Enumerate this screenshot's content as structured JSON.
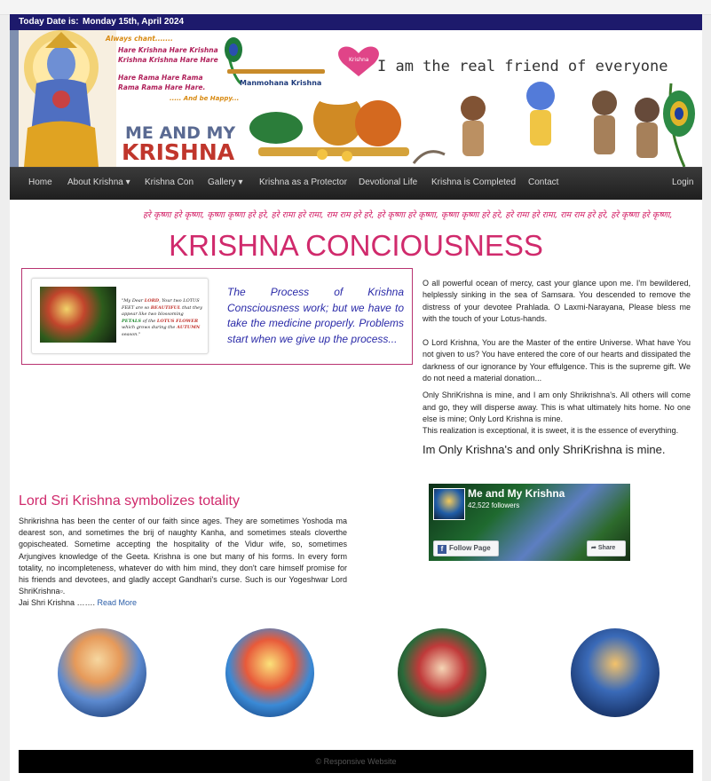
{
  "datebar": {
    "label": "Today Date is:",
    "value": "Monday 15th, April 2024"
  },
  "banner": {
    "chant_lines": [
      "Always chant.......",
      "Hare Krishna Hare Krishna",
      "Krishna Krishna Hare Hare",
      "Hare Rama Hare Rama",
      "Rama Rama Hare Hare.",
      "..... And be Happy..."
    ],
    "flute_caption": "Manmohana Krishna",
    "brand_line1": "ME AND MY",
    "brand_line2": "KRISHNA",
    "heart_label": "Krishna",
    "tagline": "I am the real friend of everyone"
  },
  "nav": {
    "items": [
      "Home",
      "About Krishna ▾",
      "Krishna Con",
      "Gallery ▾",
      "Krishna as a Protector",
      "Devotional Life",
      "Krishna is Completed",
      "Contact"
    ],
    "login": "Login"
  },
  "marquee": "हरे कृष्णा हरे कृष्णा, कृष्णा कृष्णा हरे हरे, हरे रामा हरे रामा, राम राम हरे हरे, हरे कृष्णा हरे कृष्णा, कृष्णा कृष्णा हरे हरे, हरे रामा हरे रामा, राम राम हरे हरे, हरे कृष्णा हरे कृष्णा,",
  "main_title": "KRISHNA CONCIOUSNESS",
  "quote_box": {
    "image_text": {
      "t1": "\"My Dear ",
      "t2": "LORD",
      "t3": ", Your two LOTUS FEET are so ",
      "t4": "BEAUTIFUL",
      "t5": " that they appear like two blossoming ",
      "t6": "PETALS",
      "t7": " of the ",
      "t8": "LOTUS FLOWER",
      "t9": " which grows during the ",
      "t10": "AUTUMN",
      "t11": " season.\""
    },
    "quote": "The Process of Krishna Consciousness work; but we have to take the medicine properly. Problems start when we give up the process..."
  },
  "prayers": {
    "p1": "O all powerful ocean of mercy, cast your glance upon me. I'm bewildered, helplessly sinking in the sea of Samsara. You descended to remove the distress of your devotee Prahlada. O Laxmi-Narayana, Please bless me with the touch of your Lotus-hands.",
    "p2": "O Lord Krishna, You are the Master of the entire Universe. What have You not given to us? You have entered the core of our hearts and dissipated the darkness of our ignorance by Your effulgence. This is the supreme gift. We do not need a material donation...",
    "p3": "Only ShriKrishna is mine, and I am only Shrikrishna's. All others will come and go, they will disperse away. This is what ultimately hits home. No one else is mine; Only Lord Krishna is mine.",
    "p4": "This realization is exceptional, it is sweet, it is the essence of everything.",
    "affirmation": "Im Only Krishna's and only ShriKrishna is mine."
  },
  "section": {
    "title": "Lord Sri Krishna symbolizes totality",
    "body": "Shrikrishna has been the center of our faith since ages. They are sometimes Yoshoda ma dearest son, and sometimes the brij of naughty Kanha, and sometimes steals cloverthe gopischeated. Sometime accepting the hospitality of the Vidur wife, so, sometimes Arjungives knowledge of the Geeta. Krishna is one but many of his forms. In every form totality, no incompleteness, whatever do with him mind, they don't care himself promise for his friends and devotees, and gladly accept Gandhari's curse. Such is our Yogeshwar Lord ShriKrishna▫.",
    "closing": "Jai Shri Krishna ……. ",
    "read_more": "Read More"
  },
  "facebook": {
    "page_name": "Me and My Krishna",
    "followers": "42,522 followers",
    "follow_button": "Follow Page",
    "share_button": "Share"
  },
  "footer": "© Responsive Website",
  "colors": {
    "date_bar": "#1d1a6c",
    "accent_pink": "#d02a6c",
    "nav_bg": "#2a2a2a",
    "quote_blue": "#2a2aa8",
    "link_blue": "#2a5da8"
  }
}
